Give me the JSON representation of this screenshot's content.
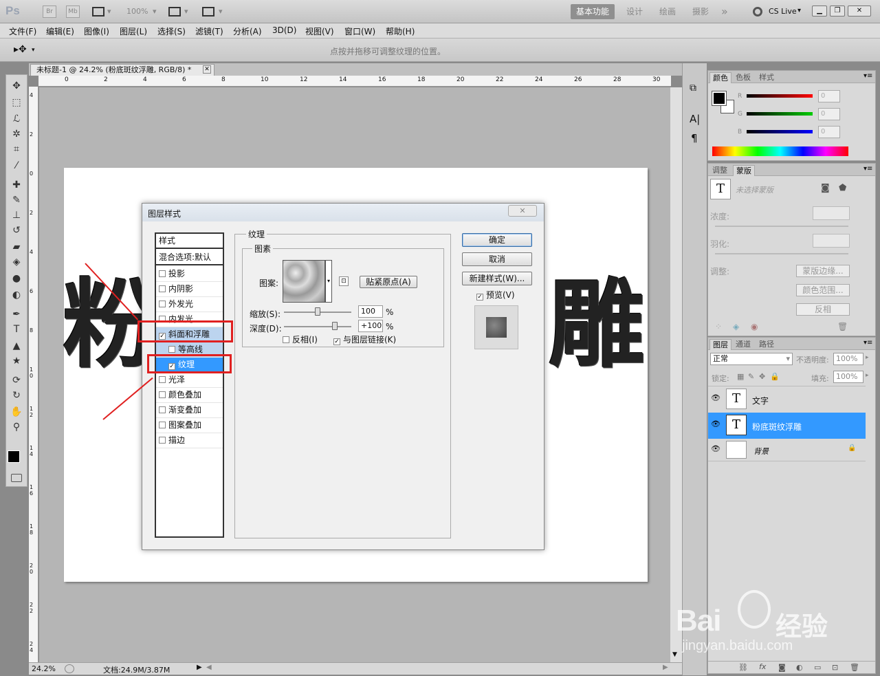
{
  "app": {
    "logo": "Ps",
    "bridge": "Br",
    "minibridge": "Mb",
    "zoom": "100%",
    "workspaces": [
      "基本功能",
      "设计",
      "绘画",
      "摄影"
    ],
    "more": "»",
    "cslive": "CS Live"
  },
  "menu": [
    "文件(F)",
    "编辑(E)",
    "图像(I)",
    "图层(L)",
    "选择(S)",
    "滤镜(T)",
    "分析(A)",
    "3D(D)",
    "视图(V)",
    "窗口(W)",
    "帮助(H)"
  ],
  "options": {
    "hint": "点按并拖移可调整纹理的位置。"
  },
  "document": {
    "tab_title": "未标题-1 @ 24.2% (粉底斑纹浮雕, RGB/8) *",
    "ruler_top": [
      "0",
      "2",
      "4",
      "6",
      "8",
      "10",
      "12",
      "14",
      "16",
      "18",
      "20",
      "22",
      "24",
      "26",
      "28",
      "30"
    ],
    "ruler_left": [
      "4",
      "2",
      "0",
      "2",
      "4",
      "6",
      "8",
      "1 0",
      "1 2",
      "1 4",
      "1 6",
      "1 8",
      "2 0",
      "2 2",
      "2 4"
    ],
    "char_left": "粉",
    "char_right": "雕",
    "zoom": "24.2%",
    "doc_info": "文档:24.9M/3.87M"
  },
  "dialog": {
    "title": "图层样式",
    "styles_header": "样式",
    "blend": "混合选项:默认",
    "items": [
      {
        "label": "投影",
        "checked": false
      },
      {
        "label": "内阴影",
        "checked": false
      },
      {
        "label": "外发光",
        "checked": false
      },
      {
        "label": "内发光",
        "checked": false
      },
      {
        "label": "斜面和浮雕",
        "checked": true
      },
      {
        "label": "等高线",
        "checked": false
      },
      {
        "label": "纹理",
        "checked": true
      },
      {
        "label": "光泽",
        "checked": false
      },
      {
        "label": "颜色叠加",
        "checked": false
      },
      {
        "label": "渐变叠加",
        "checked": false
      },
      {
        "label": "图案叠加",
        "checked": false
      },
      {
        "label": "描边",
        "checked": false
      }
    ],
    "texture_group": "纹理",
    "element_group": "图素",
    "pattern_label": "图案:",
    "snap_button": "贴紧原点(A)",
    "scale_label": "缩放(S):",
    "scale_value": "100",
    "scale_level": 0.5,
    "depth_label": "深度(D):",
    "depth_value": "+100",
    "depth_level": 0.75,
    "percent": "%",
    "invert_label": "反相(I)",
    "link_label": "与图层链接(K)",
    "ok": "确定",
    "cancel": "取消",
    "new_style": "新建样式(W)...",
    "preview_label": "预览(V)"
  },
  "color_panel": {
    "tabs": [
      "颜色",
      "色板",
      "样式"
    ],
    "channels": [
      {
        "label": "R",
        "value": "0"
      },
      {
        "label": "G",
        "value": "0"
      },
      {
        "label": "B",
        "value": "0"
      }
    ]
  },
  "adjust_panel": {
    "tabs": [
      "调整",
      "蒙版"
    ],
    "no_mask": "未选择蒙版",
    "density": "浓度:",
    "feather": "羽化:",
    "refine": "调整:",
    "mask_edge": "蒙版边缘...",
    "color_range": "颜色范围...",
    "invert": "反相"
  },
  "layers_panel": {
    "tabs": [
      "图层",
      "通道",
      "路径"
    ],
    "blend_mode": "正常",
    "opacity_label": "不透明度:",
    "opacity": "100%",
    "lock_label": "锁定:",
    "fill_label": "填充:",
    "fill": "100%",
    "layers": [
      {
        "name": "文字",
        "type": "T",
        "selected": false
      },
      {
        "name": "粉底斑纹浮雕",
        "type": "T",
        "selected": true
      },
      {
        "name": "背景",
        "type": "bg",
        "selected": false
      }
    ]
  },
  "watermark": {
    "brand": "Bai",
    "brand2": "经验",
    "url": "jingyan.baidu.com"
  }
}
